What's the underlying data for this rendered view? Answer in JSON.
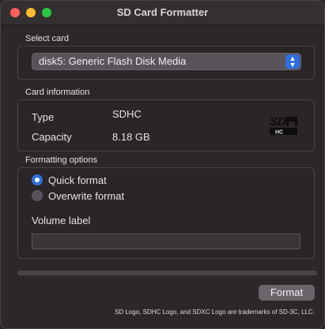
{
  "window": {
    "title": "SD Card Formatter"
  },
  "select_card": {
    "label": "Select card",
    "selected": "disk5: Generic Flash Disk Media"
  },
  "card_info": {
    "label": "Card information",
    "type_label": "Type",
    "type_value": "SDHC",
    "capacity_label": "Capacity",
    "capacity_value": "8.18 GB",
    "logo_text": "SDHC"
  },
  "formatting": {
    "label": "Formatting options",
    "quick_format": "Quick format",
    "overwrite_format": "Overwrite format",
    "selected_option": "Quick format",
    "volume_label": "Volume label",
    "volume_value": ""
  },
  "progress": {
    "value": 0
  },
  "actions": {
    "format_label": "Format"
  },
  "footer": {
    "trademark": "SD Logo, SDHC Logo, and SDXC Logo are trademarks of SD-3C, LLC."
  },
  "colors": {
    "accent": "#2f6fe0",
    "window_bg": "#2d2729"
  }
}
